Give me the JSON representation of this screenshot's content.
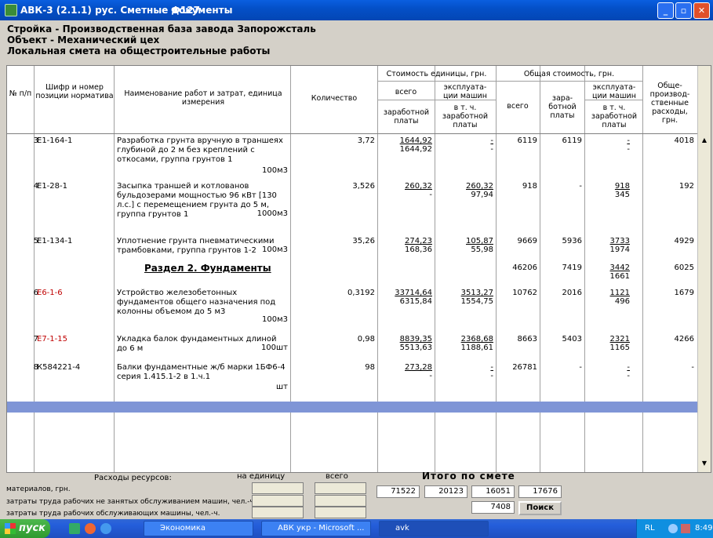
{
  "window": {
    "title_app": "АВК-3 (2.1.1)  рус.  Сметные документы",
    "title_code": "Ф127"
  },
  "header": {
    "line1": "Стройка - Производственная база завода Запорожсталь",
    "line2": "Объект - Механический цех",
    "line3": "Локальная смета на общестроительные работы"
  },
  "columns": {
    "num": "№ п/п",
    "code": "Шифр и номер позиции норматива",
    "name": "Наименование работ и затрат, единица измерения",
    "qty": "Количество",
    "unit_cost": "Стоимость единицы, грн.",
    "total_cost": "Общая стоимость, грн.",
    "all": "всего",
    "machines": "эксплуата- ции машин",
    "salary": "заработной платы",
    "incl_salary": "в т. ч. заработной платы",
    "salary2": "зара- ботной платы",
    "overhead": "Обще- производ- ственные расходы, грн."
  },
  "rows": [
    {
      "n": "3",
      "code": "Е1-164-1",
      "name": "Разработка грунта вручную в траншеях глубиной до 2 м без креплений с откосами, группа грунтов 1",
      "unit": "100м3",
      "qty": "3,72",
      "u_all": "1644,92",
      "u_sal": "1644,92",
      "u_mach": "-",
      "u_mach_sal": "-",
      "t_all": "6119",
      "t_sal": "6119",
      "t_mach": "-",
      "t_mach_sal": "-",
      "oh": "4018"
    },
    {
      "n": "4",
      "code": "Е1-28-1",
      "name": "Засыпка траншей и котлованов бульдозерами мощностью 96 кВт [130 л.с.] с перемещением грунта до 5 м, группа грунтов 1",
      "unit": "1000м3",
      "qty": "3,526",
      "u_all": "260,32",
      "u_sal": "-",
      "u_mach": "260,32",
      "u_mach_sal": "97,94",
      "t_all": "918",
      "t_sal": "-",
      "t_mach": "918",
      "t_mach_sal": "345",
      "oh": "192"
    },
    {
      "n": "5",
      "code": "Е1-134-1",
      "name": "Уплотнение грунта пневматическими трамбовками, группа грунтов 1-2",
      "unit": "100м3",
      "qty": "35,26",
      "u_all": "274,23",
      "u_sal": "168,36",
      "u_mach": "105,87",
      "u_mach_sal": "55,98",
      "t_all": "9669",
      "t_sal": "5936",
      "t_mach": "3733",
      "t_mach_sal": "1974",
      "oh": "4929"
    },
    {
      "section": "Раздел 2. Фундаменты",
      "t_all": "46206",
      "t_sal": "7419",
      "t_mach": "3442",
      "t_mach_sal": "1661",
      "oh": "6025"
    },
    {
      "n": "6",
      "code": "Е6-1-6",
      "name": "Устройство железобетонных фундаментов общего назначения под колонны объемом до 5 м3",
      "unit": "100м3",
      "qty": "0,3192",
      "u_all": "33714,64",
      "u_sal": "6315,84",
      "u_mach": "3513,27",
      "u_mach_sal": "1554,75",
      "t_all": "10762",
      "t_sal": "2016",
      "t_mach": "1121",
      "t_mach_sal": "496",
      "oh": "1679"
    },
    {
      "n": "7",
      "code": "Е7-1-15",
      "name": "Укладка балок фундаментных длиной до 6 м",
      "unit": "100шт",
      "qty": "0,98",
      "u_all": "8839,35",
      "u_sal": "5513,63",
      "u_mach": "2368,68",
      "u_mach_sal": "1188,61",
      "t_all": "8663",
      "t_sal": "5403",
      "t_mach": "2321",
      "t_mach_sal": "1165",
      "oh": "4266"
    },
    {
      "n": "8",
      "code": "К584221-4",
      "name": "Балки фундаментные ж/б марки 1БФ6-4 серия 1.415.1-2 в 1.ч.1",
      "unit": "шт",
      "qty": "98",
      "u_all": "273,28",
      "u_sal": "-",
      "u_mach": "-",
      "u_mach_sal": "-",
      "t_all": "26781",
      "t_sal": "-",
      "t_mach": "-",
      "t_mach_sal": "-",
      "oh": "-"
    }
  ],
  "resources": {
    "title": "Расходы ресурсов:",
    "per_unit": "на единицу",
    "all": "всего",
    "mat": "материалов, грн.",
    "labor_nm": "затраты труда рабочих не занятых обслуживанием машин, чел.-ч.",
    "labor_m": "затраты труда рабочих обслуживающих машины, чел.-ч."
  },
  "totals": {
    "label": "Итого  по  смете",
    "v1": "71522",
    "v2": "20123",
    "v3": "16051",
    "v4": "17676",
    "v5": "7408",
    "search": "Поиск"
  },
  "taskbar": {
    "start": "пуск",
    "b1": "Экономика",
    "b2": "АВК укр - Microsoft ...",
    "b3": "avk",
    "lang": "RL",
    "time": "8:49"
  }
}
